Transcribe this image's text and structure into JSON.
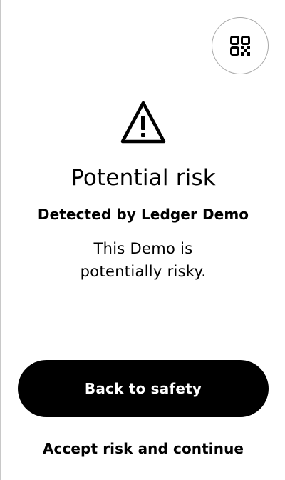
{
  "header": {
    "qr_button_icon": "qr-code-icon"
  },
  "warning": {
    "icon": "warning-triangle-icon",
    "title": "Potential risk",
    "detected_by": "Detected by Ledger Demo",
    "description": "This Demo is potentially risky."
  },
  "actions": {
    "primary_label": "Back to safety",
    "secondary_label": "Accept risk and continue"
  },
  "colors": {
    "background": "#ffffff",
    "foreground": "#000000",
    "primary_button_bg": "#000000",
    "primary_button_text": "#ffffff",
    "qr_border": "#a8a8a8"
  }
}
